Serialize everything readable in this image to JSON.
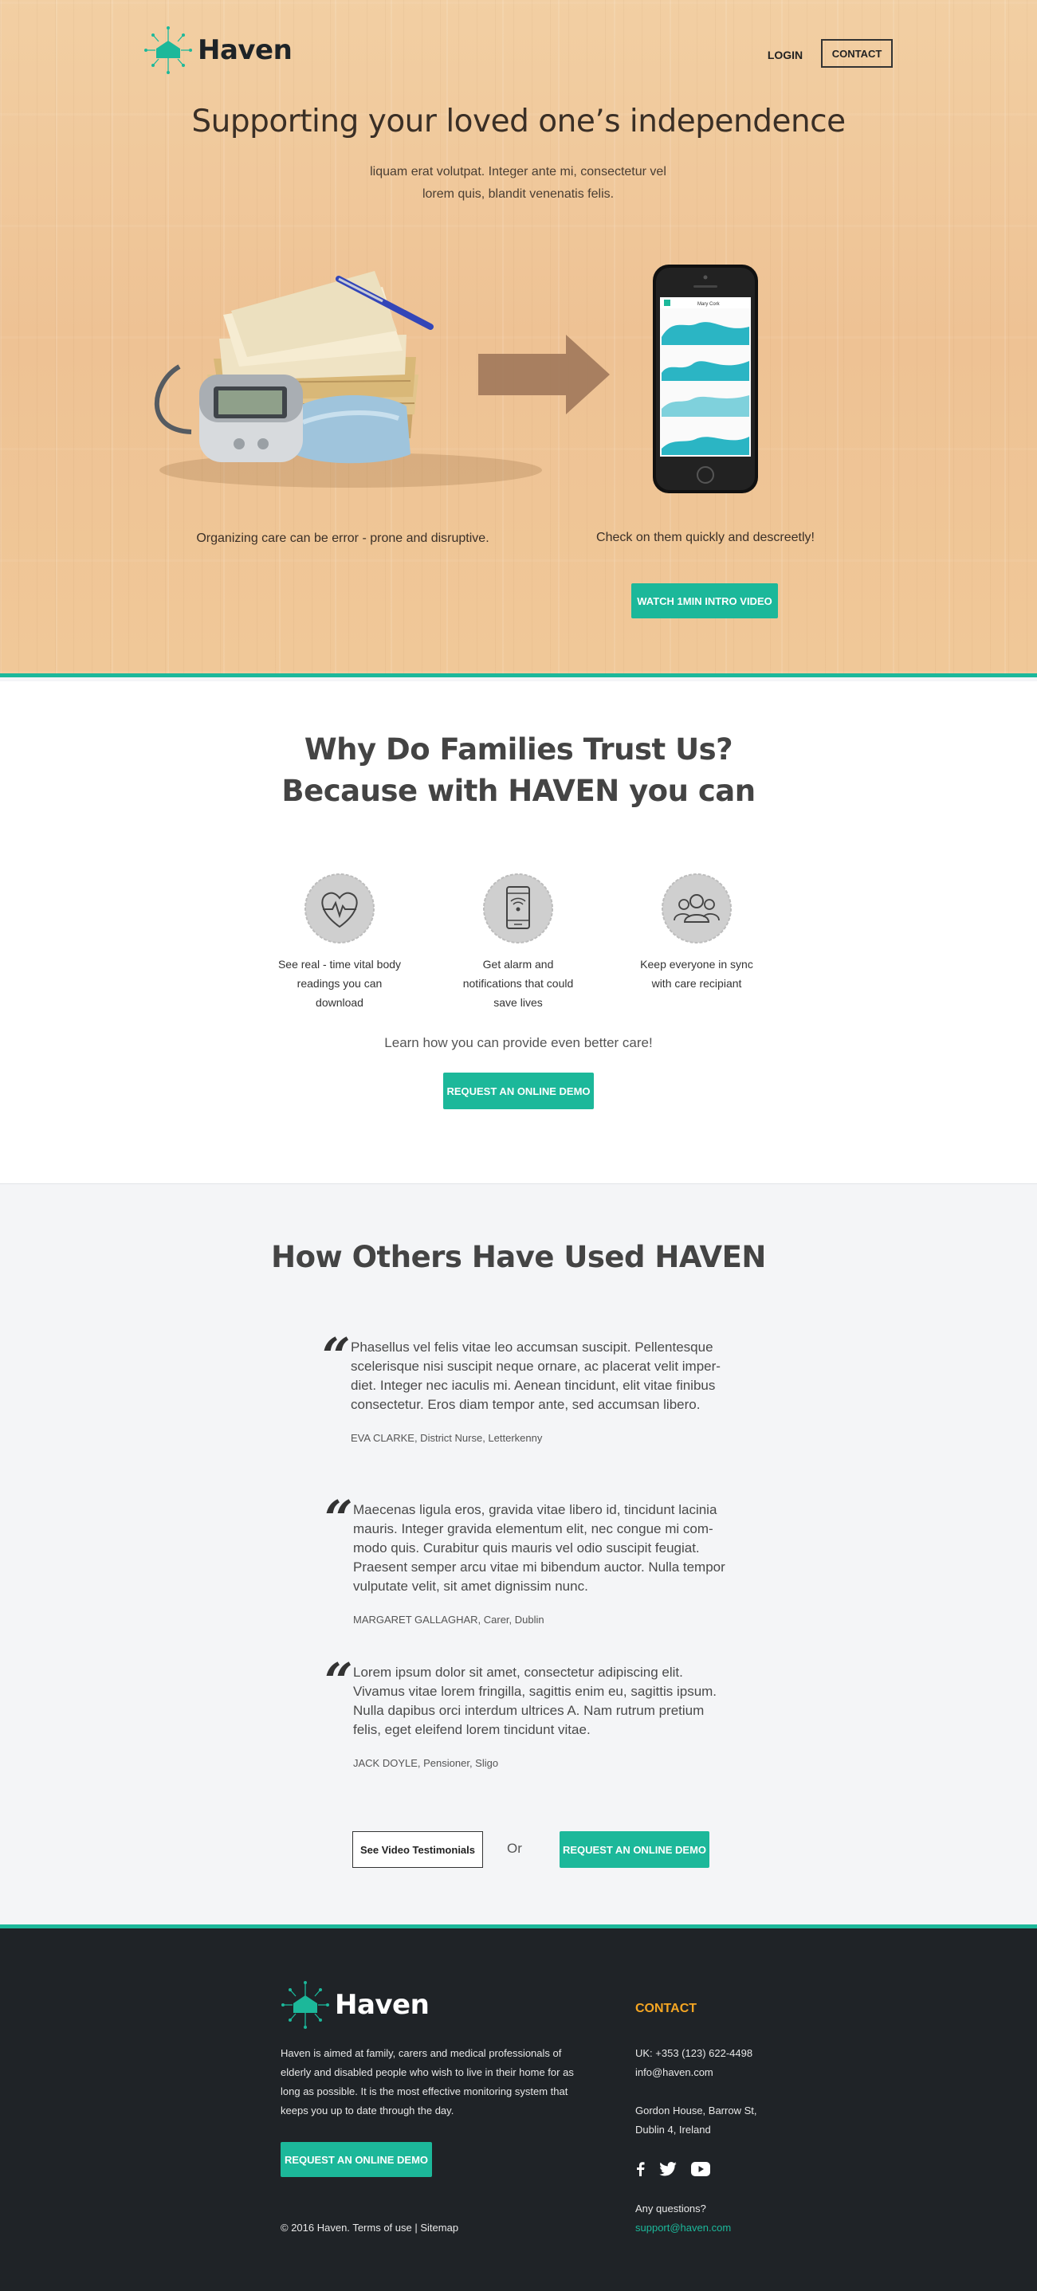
{
  "brand": {
    "name": "Haven",
    "accent": "#1cb89a",
    "footer_accent": "#f5a623",
    "footer_bg": "#1f2327"
  },
  "nav": {
    "login": "LOGIN",
    "contact": "CONTACT"
  },
  "hero": {
    "title": "Supporting your loved one’s independence",
    "subtitle": "liquam erat volutpat. Integer ante mi, consectetur vel lorem quis, blandit venenatis felis.",
    "caption_left": "Organizing care can be error - prone and disruptive.",
    "caption_right": "Check on them quickly and descreetly!",
    "video_button": "WATCH 1MIN INTRO VIDEO"
  },
  "why": {
    "title_line1": "Why Do Families Trust Us?",
    "title_line2": "Because with HAVEN you can",
    "features": [
      {
        "icon": "heart-pulse-icon",
        "text": "See real - time vital body readings you can download"
      },
      {
        "icon": "phone-alarm-icon",
        "text": "Get alarm and notifications that could save lives"
      },
      {
        "icon": "people-icon",
        "text": "Keep everyone in sync with care recipiant"
      }
    ],
    "learn_text": "Learn how you can provide even better care!",
    "demo_button": "REQUEST AN ONLINE DEMO"
  },
  "testimonials": {
    "title": "How Others Have Used HAVEN",
    "items": [
      {
        "text": "Phasellus vel felis vitae leo accumsan suscipit. Pellentesque scelerisque nisi suscipit neque ornare, ac placerat velit imper-diet. Integer nec iaculis mi. Aenean tincidunt, elit vitae finibus consectetur. Eros diam tempor ante, sed accumsan libero.",
        "author": "EVA CLARKE, District Nurse, Letterkenny"
      },
      {
        "text": "Maecenas ligula eros, gravida vitae libero id, tincidunt lacinia mauris. Integer gravida elementum elit, nec congue mi com-modo quis. Curabitur quis mauris vel odio suscipit feugiat. Praesent semper arcu vitae mi bibendum auctor. Nulla tempor vulputate velit, sit amet dignissim nunc.",
        "author": "MARGARET GALLAGHAR, Carer, Dublin"
      },
      {
        "text": "Lorem ipsum dolor sit amet, consectetur adipiscing elit. Vivamus vitae lorem fringilla, sagittis enim eu, sagittis ipsum. Nulla dapibus orci interdum ultrices A. Nam rutrum pretium felis, eget eleifend lorem tincidunt vitae.",
        "author": "JACK DOYLE, Pensioner, Sligo"
      }
    ],
    "video_button": "See Video Testimonials",
    "or_text": "Or",
    "demo_button": "REQUEST AN ONLINE DEMO"
  },
  "footer": {
    "about": "Haven is aimed at family, carers and medical professionals of elderly and disabled people who wish to live in their home for as long as possible. It is the most effective monitoring system that keeps you up to date  through the day.",
    "demo_button": "REQUEST AN ONLINE DEMO",
    "copyright": "© 2016 Haven.",
    "terms": "Terms of use",
    "separator": "|",
    "sitemap": "Sitemap",
    "contact_title": "CONTACT",
    "phone": "UK: +353 (123) 622-4498",
    "email": "info@haven.com",
    "address_line1": "Gordon House, Barrow St,",
    "address_line2": "Dublin 4, Ireland",
    "social": [
      "facebook-icon",
      "twitter-icon",
      "youtube-icon"
    ],
    "questions": "Any questions?",
    "support_email": "support@haven.com"
  }
}
